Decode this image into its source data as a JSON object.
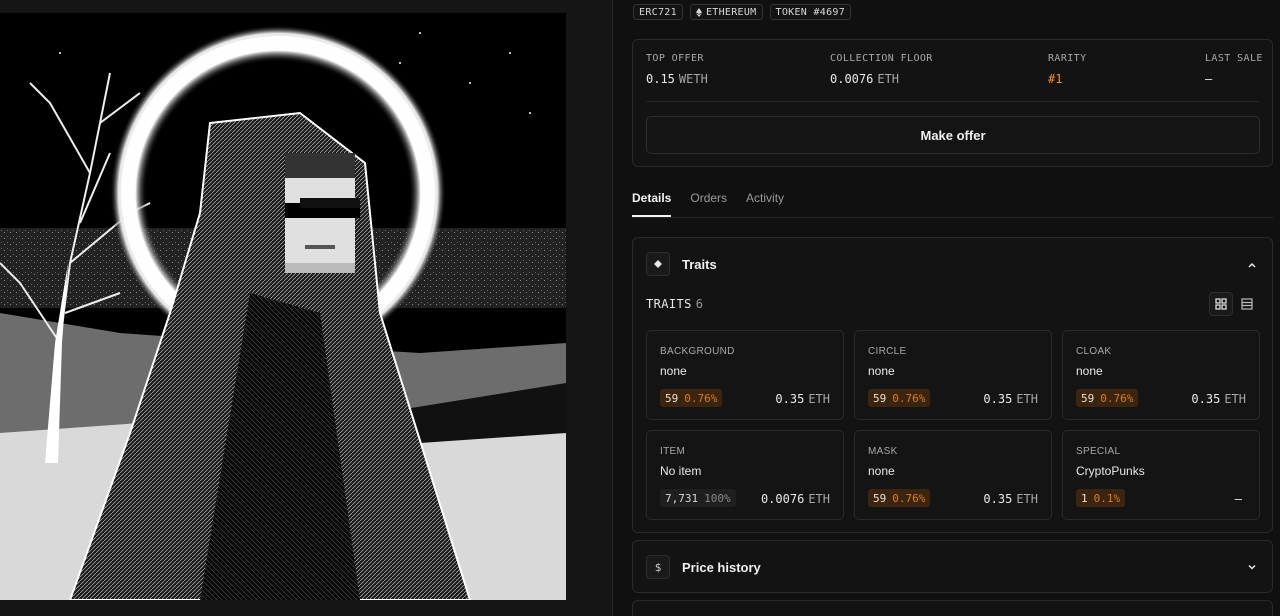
{
  "chips": [
    {
      "label": "ERC721"
    },
    {
      "label": "ETHEREUM",
      "icon": "ethereum-icon"
    },
    {
      "label": "TOKEN #4697"
    }
  ],
  "stats": {
    "top_offer": {
      "label": "TOP OFFER",
      "value": "0.15",
      "unit": "WETH"
    },
    "collection_floor": {
      "label": "COLLECTION FLOOR",
      "value": "0.0076",
      "unit": "ETH"
    },
    "rarity": {
      "label": "RARITY",
      "value": "#1"
    },
    "last_sale": {
      "label": "LAST SALE",
      "value": "–"
    }
  },
  "make_offer_label": "Make offer",
  "tabs": [
    {
      "label": "Details",
      "active": true
    },
    {
      "label": "Orders",
      "active": false
    },
    {
      "label": "Activity",
      "active": false
    }
  ],
  "traits_section": {
    "title": "Traits",
    "icon": "diamond-icon",
    "count_label": "TRAITS",
    "count": "6",
    "items": [
      {
        "type": "BACKGROUND",
        "value": "none",
        "count": "59",
        "pct": "0.76%",
        "price": "0.35",
        "unit": "ETH",
        "style": "orange"
      },
      {
        "type": "CIRCLE",
        "value": "none",
        "count": "59",
        "pct": "0.76%",
        "price": "0.35",
        "unit": "ETH",
        "style": "orange"
      },
      {
        "type": "CLOAK",
        "value": "none",
        "count": "59",
        "pct": "0.76%",
        "price": "0.35",
        "unit": "ETH",
        "style": "orange"
      },
      {
        "type": "ITEM",
        "value": "No item",
        "count": "7,731",
        "pct": "100%",
        "price": "0.0076",
        "unit": "ETH",
        "style": "grey"
      },
      {
        "type": "MASK",
        "value": "none",
        "count": "59",
        "pct": "0.76%",
        "price": "0.35",
        "unit": "ETH",
        "style": "orange"
      },
      {
        "type": "SPECIAL",
        "value": "CryptoPunks",
        "count": "1",
        "pct": "0.1%",
        "price": "–",
        "unit": "",
        "style": "orange"
      }
    ]
  },
  "price_history": {
    "title": "Price history",
    "icon": "dollar-icon"
  },
  "colors": {
    "accent": "#f28c28",
    "background": "#101010",
    "card": "#131313",
    "border": "#2a2a2a"
  }
}
